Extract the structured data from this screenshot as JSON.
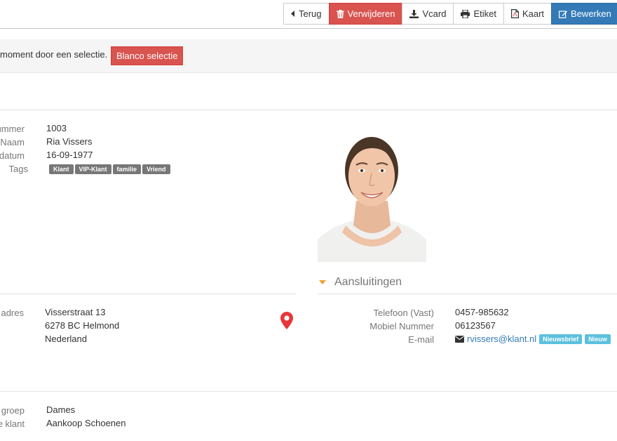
{
  "toolbar": {
    "back_label": "Terug",
    "delete_label": "Verwijderen",
    "vcard_label": "Vcard",
    "label_label": "Etiket",
    "map_label": "Kaart",
    "edit_label": "Bewerken"
  },
  "notice": {
    "text": "moment door een selectie.",
    "button_label": "Blanco selectie"
  },
  "personal": {
    "number_label": "ummer",
    "number_value": "1003",
    "name_label": "Naam",
    "name_value": "Ria Vissers",
    "birth_label": "datum",
    "birth_value": "16-09-1977",
    "tags_label": "Tags",
    "tags": [
      "Klant",
      "VIP-Klant",
      "familie",
      "Vriend"
    ]
  },
  "address": {
    "label": "adres",
    "line1": "Visserstraat 13",
    "line2": "6278 BC Helmond",
    "line3": "Nederland"
  },
  "connections": {
    "title": "Aansluitingen",
    "phone_label": "Telefoon (Vast)",
    "phone_value": "0457-985632",
    "mobile_label": "Mobiel Nummer",
    "mobile_value": "06123567",
    "email_label": "E-mail",
    "email_value": "rvissers@klant.nl",
    "badges": [
      "Nieuwsbrief",
      "Nieuw"
    ]
  },
  "extra": {
    "group_label": "groep",
    "group_value": "Dames",
    "type_label": "e klant",
    "type_value": "Aankoop Schoenen"
  },
  "colors": {
    "danger": "#d9534f",
    "primary": "#337ab7",
    "tag_gray": "#777777",
    "badge_info": "#5bc0de",
    "accent_orange": "#f0a030",
    "pin_red": "#e8353a"
  }
}
